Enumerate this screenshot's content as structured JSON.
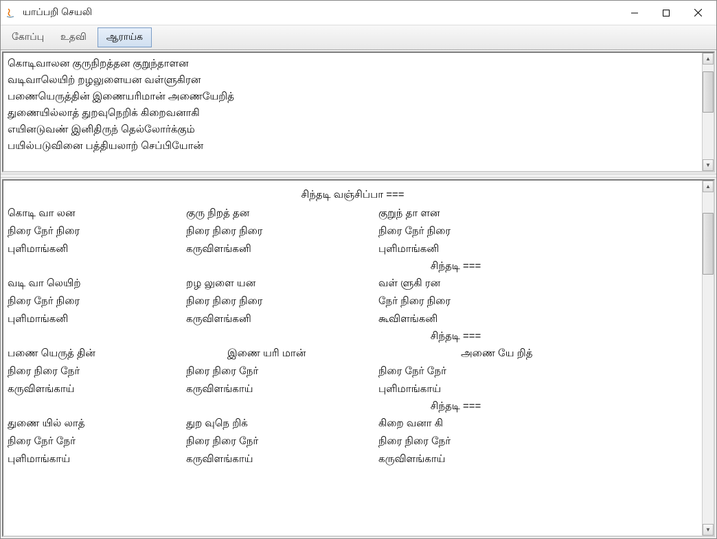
{
  "window": {
    "title": "யாப்பறி செயலி"
  },
  "toolbar": {
    "menu1": "கோப்பு",
    "menu2": "உதவி",
    "button": "ஆராய்க"
  },
  "input": {
    "lines": [
      "கொடிவாலன குருநிறத்தன குறுந்தாளன",
      "வடிவாலெயிற் றழலுளையன வள்ளுகிரன",
      "பணையெருத்தின் இணையரிமான் அணையேறித்",
      "துணையில்லாத் துறவுநெறிக் கிறைவனாகி",
      "எயினடுவண் இனிதிருந் தெல்லோர்க்கும்",
      "பயில்படுவினை பத்தியலாற் செப்பியோன்"
    ]
  },
  "analysis": {
    "title": "சிந்தடி வஞ்சிப்பா ===",
    "separator": "சிந்தடி ===",
    "blocks": [
      {
        "type": "narrow",
        "syllables": [
          "கொடி வா லன",
          "குரு நிறத் தன",
          "குறுந் தா ளன"
        ],
        "pattern": [
          "நிரை நேர் நிரை",
          "நிரை நிரை நிரை",
          "நிரை நேர் நிரை"
        ],
        "classification": [
          "புளிமாங்கனி",
          "கருவிளங்கனி",
          "புளிமாங்கனி"
        ]
      },
      {
        "type": "narrow",
        "syllables": [
          "வடி வா லெயிற்",
          "றழ லுளை யன",
          "வள் ளுகி ரன"
        ],
        "pattern": [
          "நிரை நேர் நிரை",
          "நிரை நிரை நிரை",
          "நேர் நிரை நிரை"
        ],
        "classification": [
          "புளிமாங்கனி",
          "கருவிளங்கனி",
          "கூவிளங்கனி"
        ]
      },
      {
        "type": "wide",
        "syllables": [
          "பணை யெருத் தின்",
          "இணை யரி மான்",
          "அணை யே றித்"
        ],
        "pattern": [
          "நிரை நிரை நேர்",
          "நிரை நிரை நேர்",
          "நிரை நேர் நேர்"
        ],
        "classification": [
          "கருவிளங்காய்",
          "கருவிளங்காய்",
          "புளிமாங்காய்"
        ]
      },
      {
        "type": "narrow",
        "syllables": [
          "துணை யில் லாத்",
          "துற வுநெ றிக்",
          "கிறை வனா கி"
        ],
        "pattern": [
          "நிரை நேர் நேர்",
          "நிரை நிரை நேர்",
          "நிரை நிரை நேர்"
        ],
        "classification": [
          "புளிமாங்காய்",
          "கருவிளங்காய்",
          "கருவிளங்காய்"
        ]
      }
    ]
  }
}
